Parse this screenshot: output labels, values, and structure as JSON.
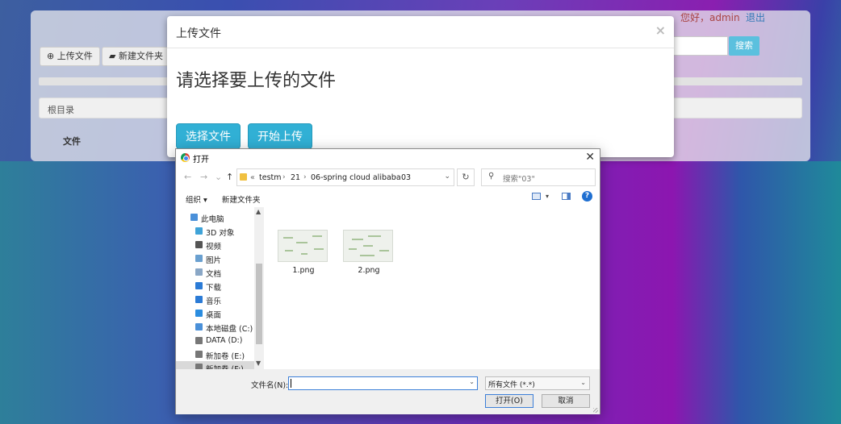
{
  "page": {
    "toolbar": {
      "upload_label": "上传文件",
      "new_folder_label": "新建文件夹"
    },
    "user": {
      "greeting": "您好，admin",
      "logout": "退出"
    },
    "search": {
      "button": "搜索"
    },
    "breadcrumb": "根目录",
    "table_header_file": "文件"
  },
  "modal": {
    "title": "上传文件",
    "close": "×",
    "heading": "请选择要上传的文件",
    "choose_button": "选择文件",
    "start_button": "开始上传"
  },
  "dialog": {
    "title": "打开",
    "close": "✕",
    "nav": {
      "back": "←",
      "forward": "→",
      "recent": "⌄",
      "up": "↑"
    },
    "address": {
      "prefix": "«",
      "crumbs": [
        "testm",
        "21",
        "06-spring cloud alibaba",
        "03"
      ],
      "sep": "›"
    },
    "search_placeholder": "搜索\"03\"",
    "toolbar": {
      "organize": "组织 ▾",
      "new_folder": "新建文件夹",
      "help": "?"
    },
    "sidebar": [
      {
        "label": "此电脑",
        "icon": "computer-icon",
        "color": "#4a90d9"
      },
      {
        "label": "3D 对象",
        "icon": "cube-3d-icon",
        "color": "#3fa3d8"
      },
      {
        "label": "视频",
        "icon": "video-icon",
        "color": "#555555"
      },
      {
        "label": "图片",
        "icon": "pictures-icon",
        "color": "#6aa0d0"
      },
      {
        "label": "文档",
        "icon": "documents-icon",
        "color": "#8aa7c6"
      },
      {
        "label": "下载",
        "icon": "download-icon",
        "color": "#2b7bd6"
      },
      {
        "label": "音乐",
        "icon": "music-icon",
        "color": "#2b7bd6"
      },
      {
        "label": "桌面",
        "icon": "desktop-icon",
        "color": "#2b8de0"
      },
      {
        "label": "本地磁盘 (C:)",
        "icon": "drive-c-icon",
        "color": "#4a90d9"
      },
      {
        "label": "DATA (D:)",
        "icon": "drive-icon",
        "color": "#777777"
      },
      {
        "label": "新加卷 (E:)",
        "icon": "drive-icon",
        "color": "#777777"
      },
      {
        "label": "新加卷 (F:)",
        "icon": "drive-icon",
        "color": "#777777"
      }
    ],
    "files": [
      {
        "name": "1.png"
      },
      {
        "name": "2.png"
      }
    ],
    "filename_label": "文件名(N):",
    "filename_value": "",
    "filetype": "所有文件 (*.*)",
    "open_button": "打开(O)",
    "cancel_button": "取消"
  }
}
